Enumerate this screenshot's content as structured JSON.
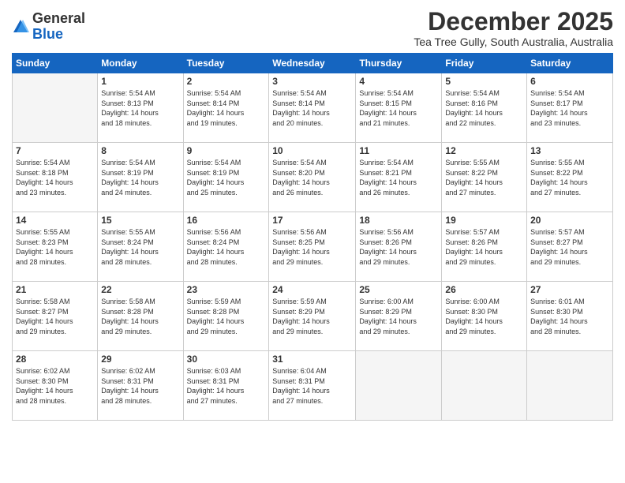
{
  "logo": {
    "general": "General",
    "blue": "Blue"
  },
  "header": {
    "month_title": "December 2025",
    "subtitle": "Tea Tree Gully, South Australia, Australia"
  },
  "weekdays": [
    "Sunday",
    "Monday",
    "Tuesday",
    "Wednesday",
    "Thursday",
    "Friday",
    "Saturday"
  ],
  "weeks": [
    [
      {
        "day": "",
        "info": ""
      },
      {
        "day": "1",
        "info": "Sunrise: 5:54 AM\nSunset: 8:13 PM\nDaylight: 14 hours\nand 18 minutes."
      },
      {
        "day": "2",
        "info": "Sunrise: 5:54 AM\nSunset: 8:14 PM\nDaylight: 14 hours\nand 19 minutes."
      },
      {
        "day": "3",
        "info": "Sunrise: 5:54 AM\nSunset: 8:14 PM\nDaylight: 14 hours\nand 20 minutes."
      },
      {
        "day": "4",
        "info": "Sunrise: 5:54 AM\nSunset: 8:15 PM\nDaylight: 14 hours\nand 21 minutes."
      },
      {
        "day": "5",
        "info": "Sunrise: 5:54 AM\nSunset: 8:16 PM\nDaylight: 14 hours\nand 22 minutes."
      },
      {
        "day": "6",
        "info": "Sunrise: 5:54 AM\nSunset: 8:17 PM\nDaylight: 14 hours\nand 23 minutes."
      }
    ],
    [
      {
        "day": "7",
        "info": "Sunrise: 5:54 AM\nSunset: 8:18 PM\nDaylight: 14 hours\nand 23 minutes."
      },
      {
        "day": "8",
        "info": "Sunrise: 5:54 AM\nSunset: 8:19 PM\nDaylight: 14 hours\nand 24 minutes."
      },
      {
        "day": "9",
        "info": "Sunrise: 5:54 AM\nSunset: 8:19 PM\nDaylight: 14 hours\nand 25 minutes."
      },
      {
        "day": "10",
        "info": "Sunrise: 5:54 AM\nSunset: 8:20 PM\nDaylight: 14 hours\nand 26 minutes."
      },
      {
        "day": "11",
        "info": "Sunrise: 5:54 AM\nSunset: 8:21 PM\nDaylight: 14 hours\nand 26 minutes."
      },
      {
        "day": "12",
        "info": "Sunrise: 5:55 AM\nSunset: 8:22 PM\nDaylight: 14 hours\nand 27 minutes."
      },
      {
        "day": "13",
        "info": "Sunrise: 5:55 AM\nSunset: 8:22 PM\nDaylight: 14 hours\nand 27 minutes."
      }
    ],
    [
      {
        "day": "14",
        "info": "Sunrise: 5:55 AM\nSunset: 8:23 PM\nDaylight: 14 hours\nand 28 minutes."
      },
      {
        "day": "15",
        "info": "Sunrise: 5:55 AM\nSunset: 8:24 PM\nDaylight: 14 hours\nand 28 minutes."
      },
      {
        "day": "16",
        "info": "Sunrise: 5:56 AM\nSunset: 8:24 PM\nDaylight: 14 hours\nand 28 minutes."
      },
      {
        "day": "17",
        "info": "Sunrise: 5:56 AM\nSunset: 8:25 PM\nDaylight: 14 hours\nand 29 minutes."
      },
      {
        "day": "18",
        "info": "Sunrise: 5:56 AM\nSunset: 8:26 PM\nDaylight: 14 hours\nand 29 minutes."
      },
      {
        "day": "19",
        "info": "Sunrise: 5:57 AM\nSunset: 8:26 PM\nDaylight: 14 hours\nand 29 minutes."
      },
      {
        "day": "20",
        "info": "Sunrise: 5:57 AM\nSunset: 8:27 PM\nDaylight: 14 hours\nand 29 minutes."
      }
    ],
    [
      {
        "day": "21",
        "info": "Sunrise: 5:58 AM\nSunset: 8:27 PM\nDaylight: 14 hours\nand 29 minutes."
      },
      {
        "day": "22",
        "info": "Sunrise: 5:58 AM\nSunset: 8:28 PM\nDaylight: 14 hours\nand 29 minutes."
      },
      {
        "day": "23",
        "info": "Sunrise: 5:59 AM\nSunset: 8:28 PM\nDaylight: 14 hours\nand 29 minutes."
      },
      {
        "day": "24",
        "info": "Sunrise: 5:59 AM\nSunset: 8:29 PM\nDaylight: 14 hours\nand 29 minutes."
      },
      {
        "day": "25",
        "info": "Sunrise: 6:00 AM\nSunset: 8:29 PM\nDaylight: 14 hours\nand 29 minutes."
      },
      {
        "day": "26",
        "info": "Sunrise: 6:00 AM\nSunset: 8:30 PM\nDaylight: 14 hours\nand 29 minutes."
      },
      {
        "day": "27",
        "info": "Sunrise: 6:01 AM\nSunset: 8:30 PM\nDaylight: 14 hours\nand 28 minutes."
      }
    ],
    [
      {
        "day": "28",
        "info": "Sunrise: 6:02 AM\nSunset: 8:30 PM\nDaylight: 14 hours\nand 28 minutes."
      },
      {
        "day": "29",
        "info": "Sunrise: 6:02 AM\nSunset: 8:31 PM\nDaylight: 14 hours\nand 28 minutes."
      },
      {
        "day": "30",
        "info": "Sunrise: 6:03 AM\nSunset: 8:31 PM\nDaylight: 14 hours\nand 27 minutes."
      },
      {
        "day": "31",
        "info": "Sunrise: 6:04 AM\nSunset: 8:31 PM\nDaylight: 14 hours\nand 27 minutes."
      },
      {
        "day": "",
        "info": ""
      },
      {
        "day": "",
        "info": ""
      },
      {
        "day": "",
        "info": ""
      }
    ]
  ]
}
